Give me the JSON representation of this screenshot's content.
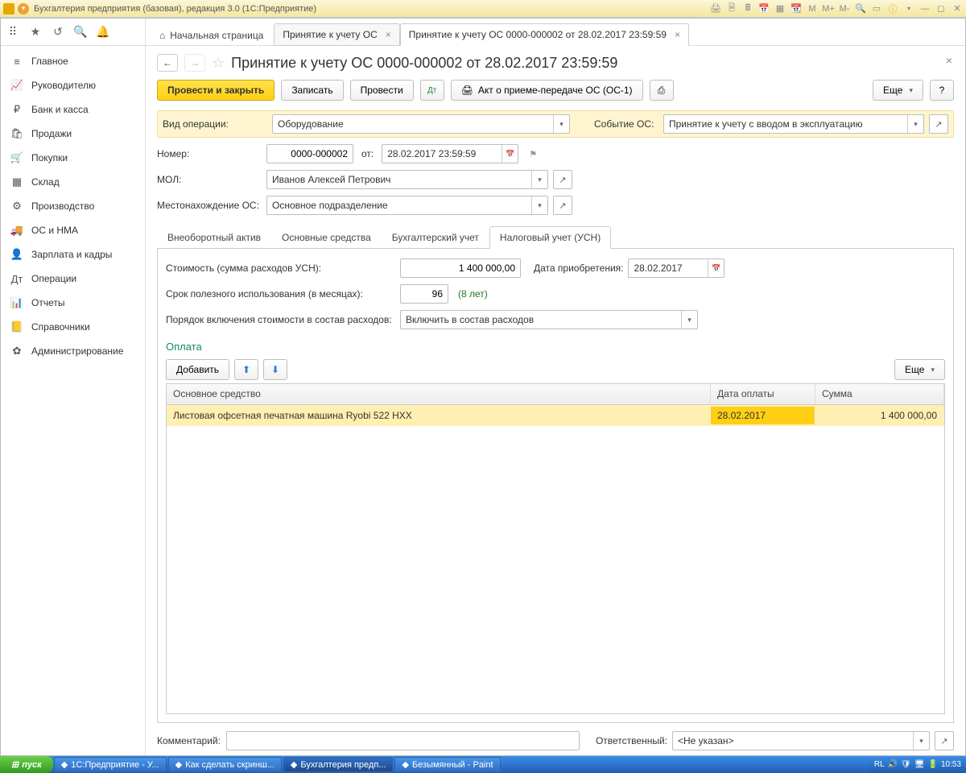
{
  "window": {
    "title": "Бухгалтерия предприятия (базовая), редакция 3.0  (1С:Предприятие)"
  },
  "titlebar_icons": {
    "m": "M",
    "mplus": "M+",
    "mminus": "M-"
  },
  "sidebar": [
    {
      "icon": "≡",
      "label": "Главное"
    },
    {
      "icon": "📈",
      "label": "Руководителю"
    },
    {
      "icon": "₽",
      "label": "Банк и касса"
    },
    {
      "icon": "🛍",
      "label": "Продажи"
    },
    {
      "icon": "🛒",
      "label": "Покупки"
    },
    {
      "icon": "▦",
      "label": "Склад"
    },
    {
      "icon": "⚙",
      "label": "Производство"
    },
    {
      "icon": "🚚",
      "label": "ОС и НМА"
    },
    {
      "icon": "👤",
      "label": "Зарплата и кадры"
    },
    {
      "icon": "Дт",
      "label": "Операции"
    },
    {
      "icon": "📊",
      "label": "Отчеты"
    },
    {
      "icon": "📒",
      "label": "Справочники"
    },
    {
      "icon": "✿",
      "label": "Администрирование"
    }
  ],
  "tabs": {
    "home": "Начальная страница",
    "t1": "Принятие к учету ОС",
    "t2": "Принятие к учету ОС 0000-000002 от 28.02.2017 23:59:59"
  },
  "doc": {
    "title": "Принятие к учету ОС 0000-000002 от 28.02.2017 23:59:59",
    "btn_post_close": "Провести и закрыть",
    "btn_save": "Записать",
    "btn_post": "Провести",
    "btn_act": "Акт о приеме-передаче ОС (ОС-1)",
    "btn_more": "Еще",
    "btn_help": "?",
    "lbl_op": "Вид операции:",
    "val_op": "Оборудование",
    "lbl_event": "Событие ОС:",
    "val_event": "Принятие к учету с вводом в эксплуатацию",
    "lbl_num": "Номер:",
    "val_num": "0000-000002",
    "lbl_from": "от:",
    "val_date": "28.02.2017 23:59:59",
    "lbl_mol": "МОЛ:",
    "val_mol": "Иванов Алексей Петрович",
    "lbl_loc": "Местонахождение ОС:",
    "val_loc": "Основное подразделение",
    "itabs": [
      "Внеоборотный актив",
      "Основные средства",
      "Бухгалтерский учет",
      "Налоговый учет (УСН)"
    ],
    "lbl_cost": "Стоимость (сумма расходов УСН):",
    "val_cost": "1 400 000,00",
    "lbl_acq": "Дата приобретения:",
    "val_acq": "28.02.2017",
    "lbl_life": "Срок полезного использования (в месяцах):",
    "val_life": "96",
    "hint_life": "(8 лет)",
    "lbl_order": "Порядок включения стоимости в состав расходов:",
    "val_order": "Включить в состав расходов",
    "section_payment": "Оплата",
    "btn_add": "Добавить",
    "table": {
      "h1": "Основное средство",
      "h2": "Дата оплаты",
      "h3": "Сумма",
      "rows": [
        {
          "name": "Листовая офсетная печатная машина Ryobi 522 HXX",
          "date": "28.02.2017",
          "sum": "1 400 000,00"
        }
      ]
    },
    "lbl_comment": "Комментарий:",
    "lbl_resp": "Ответственный:",
    "val_resp": "<Не указан>"
  },
  "taskbar": {
    "start": "пуск",
    "tasks": [
      "1С:Предприятие - У...",
      "Как сделать скринш...",
      "Бухгалтерия предп...",
      "Безымянный - Paint"
    ],
    "lang": "RL",
    "time": "10:53"
  }
}
